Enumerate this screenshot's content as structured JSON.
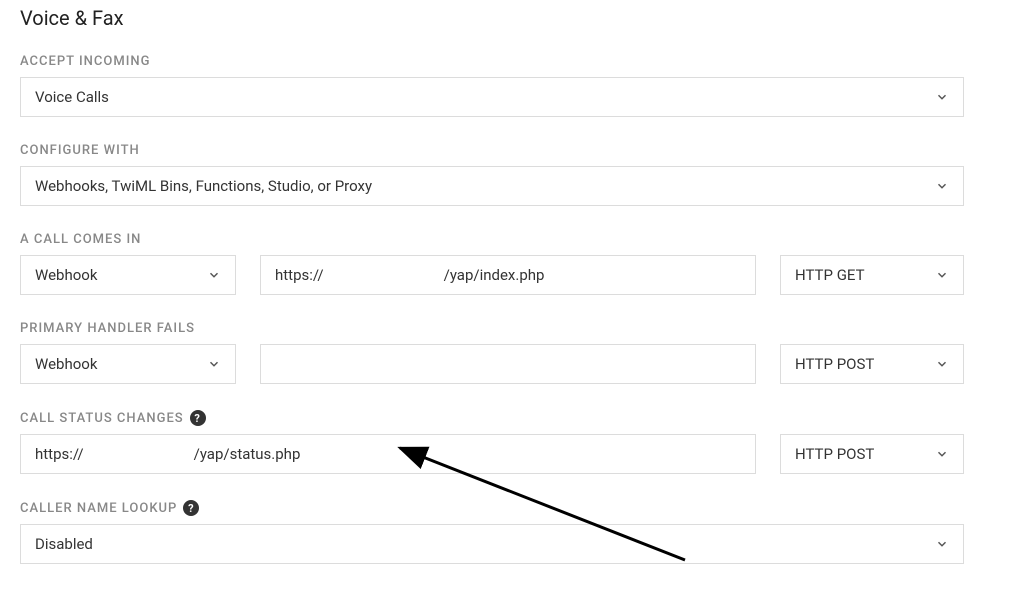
{
  "title": "Voice & Fax",
  "accept_incoming": {
    "label": "ACCEPT INCOMING",
    "value": "Voice Calls"
  },
  "configure_with": {
    "label": "CONFIGURE WITH",
    "value": "Webhooks, TwiML Bins, Functions, Studio, or Proxy"
  },
  "call_comes_in": {
    "label": "A CALL COMES IN",
    "handler": "Webhook",
    "url_prefix": "https://",
    "url_suffix": "/yap/index.php",
    "method": "HTTP GET"
  },
  "primary_handler_fails": {
    "label": "PRIMARY HANDLER FAILS",
    "handler": "Webhook",
    "url": "",
    "method": "HTTP POST"
  },
  "call_status_changes": {
    "label": "CALL STATUS CHANGES",
    "url_prefix": "https://",
    "url_suffix": "/yap/status.php",
    "method": "HTTP POST"
  },
  "caller_name_lookup": {
    "label": "CALLER NAME LOOKUP",
    "value": "Disabled"
  }
}
